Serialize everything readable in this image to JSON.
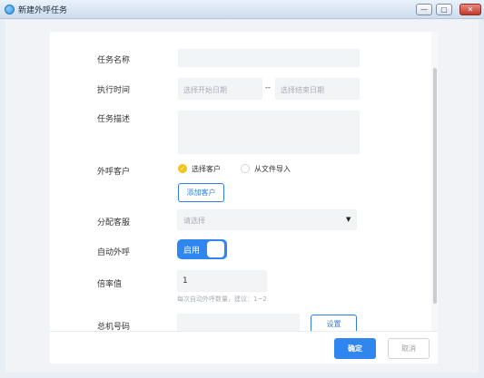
{
  "window": {
    "title": "新建外呼任务",
    "icon": "app-globe-icon",
    "controls": {
      "minimize": "—",
      "maximize": "▢",
      "close": "✕"
    }
  },
  "form": {
    "task_name": {
      "label": "任务名称",
      "value": ""
    },
    "exec_time": {
      "label": "执行时间",
      "start_placeholder": "选择开始日期",
      "separator": "--",
      "end_placeholder": "选择结束日期"
    },
    "task_desc": {
      "label": "任务描述",
      "value": ""
    },
    "customers": {
      "label": "外呼客户",
      "options": [
        {
          "label": "选择客户",
          "selected": true
        },
        {
          "label": "从文件导入",
          "selected": false
        }
      ],
      "add_button": "添加客户"
    },
    "agent": {
      "label": "分配客服",
      "placeholder": "请选择",
      "arrow": "▼"
    },
    "auto_call": {
      "label": "自动外呼",
      "toggle_text": "启用",
      "enabled": true
    },
    "ratio": {
      "label": "倍率值",
      "value": "1",
      "hint": "每次自动外呼数量，建议：1~2"
    },
    "trunk": {
      "label": "总机号码",
      "set_button": "设置"
    }
  },
  "footer": {
    "confirm": "确定",
    "cancel": "取消"
  },
  "colors": {
    "accent": "#2f86ee",
    "radio_selected": "#f2c31a",
    "input_bg": "#f3f4f6"
  }
}
